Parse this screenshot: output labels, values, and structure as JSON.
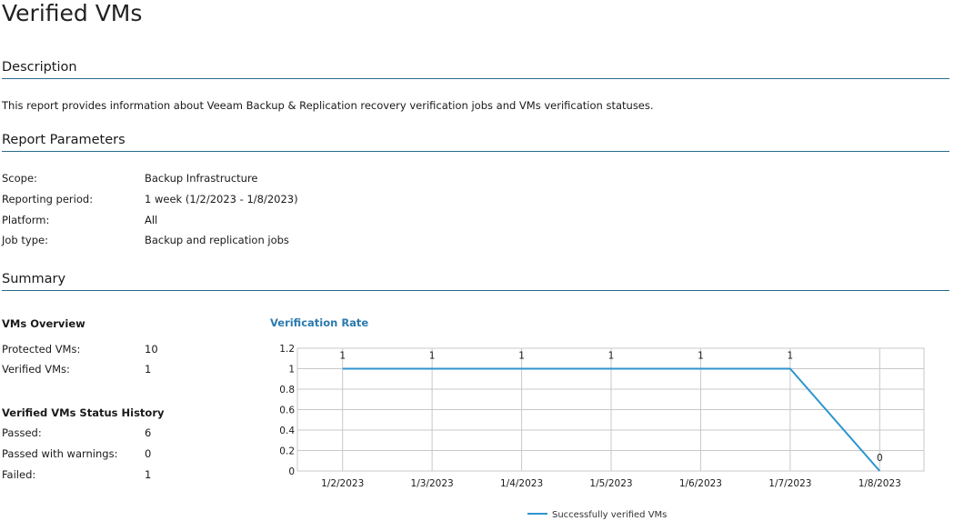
{
  "page": {
    "title": "Verified VMs"
  },
  "description": {
    "heading": "Description",
    "text": "This report provides information about Veeam Backup & Replication recovery verification jobs and VMs verification statuses."
  },
  "parameters": {
    "heading": "Report Parameters",
    "rows": [
      {
        "label": "Scope:",
        "value": "Backup Infrastructure"
      },
      {
        "label": "Reporting period:",
        "value": "1 week (1/2/2023 - 1/8/2023)"
      },
      {
        "label": "Platform:",
        "value": "All"
      },
      {
        "label": "Job type:",
        "value": "Backup and replication jobs"
      }
    ]
  },
  "summary": {
    "heading": "Summary",
    "overview": {
      "heading": "VMs Overview",
      "rows": [
        {
          "label": "Protected VMs:",
          "value": "10"
        },
        {
          "label": "Verified VMs:",
          "value": "1"
        }
      ]
    },
    "history": {
      "heading": "Verified VMs Status History",
      "rows": [
        {
          "label": "Passed:",
          "value": "6"
        },
        {
          "label": "Passed with warnings:",
          "value": "0"
        },
        {
          "label": "Failed:",
          "value": "1"
        }
      ]
    }
  },
  "chart_data": {
    "type": "line",
    "title": "Verification Rate",
    "categories": [
      "1/2/2023",
      "1/3/2023",
      "1/4/2023",
      "1/5/2023",
      "1/6/2023",
      "1/7/2023",
      "1/8/2023"
    ],
    "series": [
      {
        "name": "Successfully verified VMs",
        "values": [
          1,
          1,
          1,
          1,
          1,
          1,
          0
        ],
        "color": "#2e95cf"
      }
    ],
    "ylim": [
      0,
      1.2
    ],
    "yticks": [
      "0",
      "0.2",
      "0.4",
      "0.6",
      "0.8",
      "1",
      "1.2"
    ],
    "grid": true,
    "legend": "bottom-center",
    "data_labels": true
  }
}
